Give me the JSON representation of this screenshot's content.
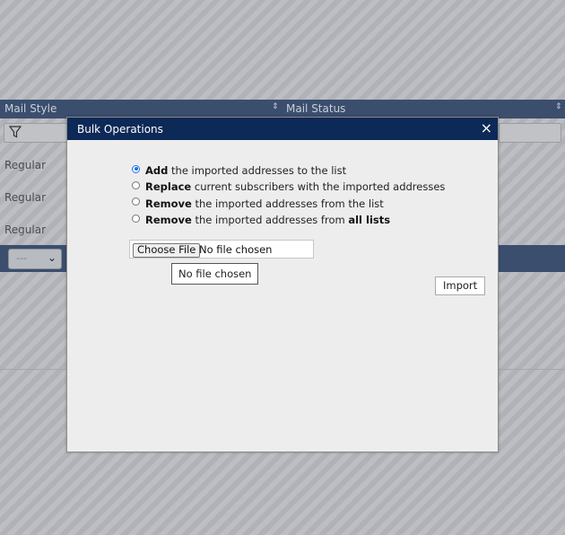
{
  "background": {
    "columns": [
      "Mail Style",
      "Mail Status"
    ],
    "sort_glyph": "⇕",
    "rows": [
      "Regular",
      "Regular",
      "Regular"
    ],
    "page_select_value": "---"
  },
  "dialog": {
    "title": "Bulk Operations",
    "close_glyph": "×",
    "options": [
      {
        "bold": "Add",
        "rest": " the imported addresses to the list",
        "rest_bold": "",
        "checked": true
      },
      {
        "bold": "Replace",
        "rest": " current subscribers with the imported addresses",
        "rest_bold": "",
        "checked": false
      },
      {
        "bold": "Remove",
        "rest": " the imported addresses from the list",
        "rest_bold": "",
        "checked": false
      },
      {
        "bold": "Remove",
        "rest": " the imported addresses from ",
        "rest_bold": "all lists",
        "checked": false
      }
    ],
    "file_button_label": "Choose File",
    "file_status": "No file chosen",
    "tooltip": "No file chosen",
    "import_label": "Import"
  }
}
